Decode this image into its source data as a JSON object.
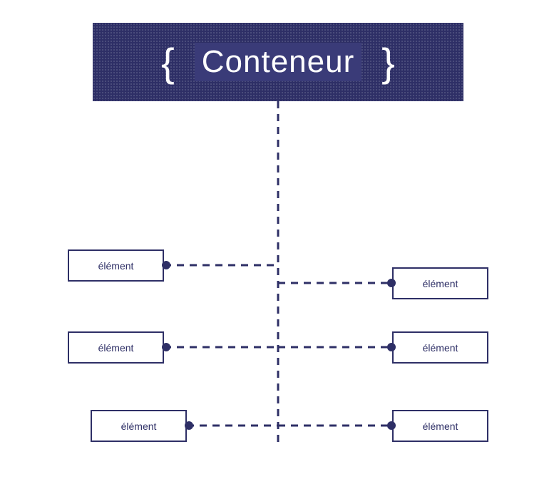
{
  "colors": {
    "primary": "#2e2f66",
    "labelBg": "#3a3b78",
    "text": "#ffffff"
  },
  "container": {
    "brace_open": "{",
    "brace_close": "}",
    "label": "Conteneur"
  },
  "elements": {
    "left": [
      {
        "label": "élément"
      },
      {
        "label": "élément"
      },
      {
        "label": "élément"
      }
    ],
    "right": [
      {
        "label": "élément"
      },
      {
        "label": "élément"
      },
      {
        "label": "élément"
      }
    ]
  }
}
